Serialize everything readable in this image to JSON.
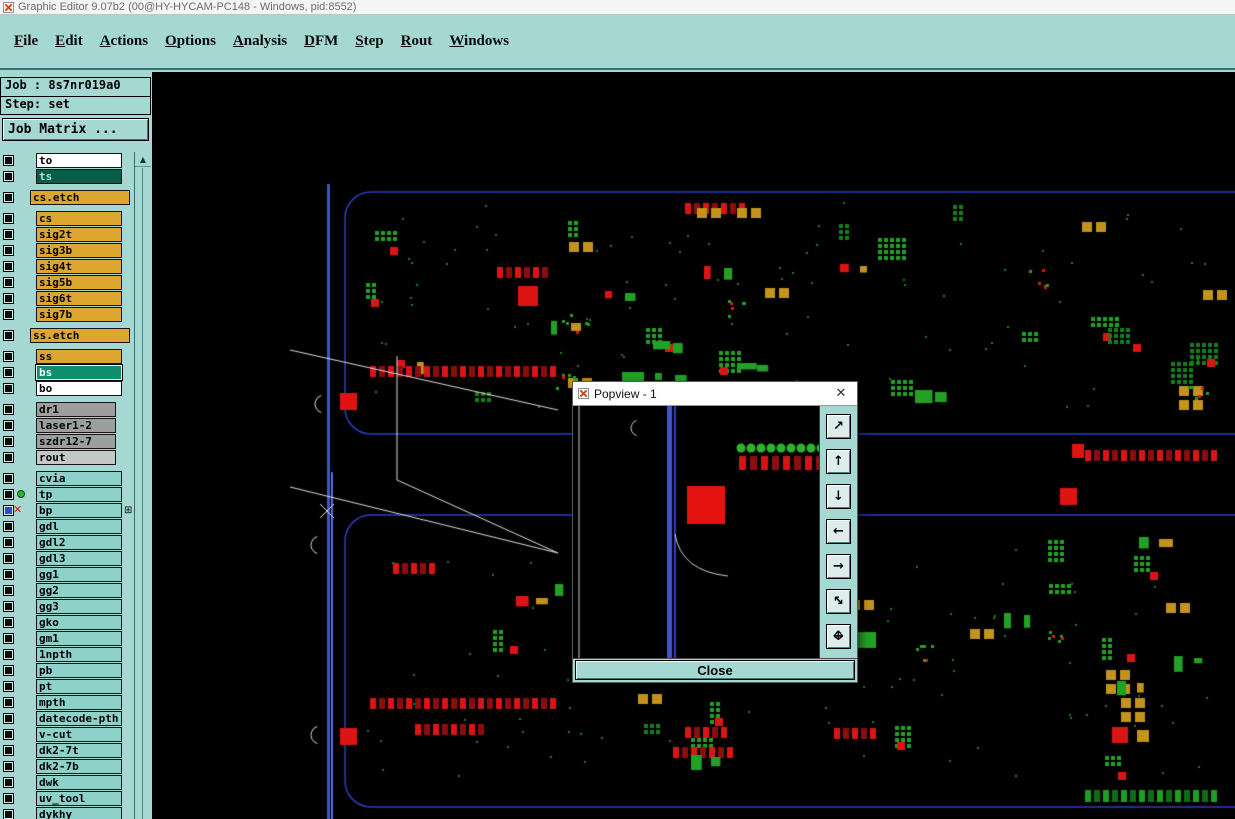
{
  "window": {
    "title": "Graphic Editor 9.07b2 (00@HY-HYCAM-PC148 - Windows, pid:8552)"
  },
  "menu": {
    "items": [
      "File",
      "Edit",
      "Actions",
      "Options",
      "Analysis",
      "DFM",
      "Step",
      "Rout",
      "Windows"
    ]
  },
  "job_panel": {
    "job_label": "Job : 8s7nr019a0",
    "step_label": "Step: set",
    "job_matrix_button": "Job Matrix ..."
  },
  "layers": [
    {
      "name": "to",
      "style": "white"
    },
    {
      "name": "ts",
      "style": "dark"
    },
    {
      "name": "cs.etch",
      "style": "gold",
      "gap": true,
      "wide": true
    },
    {
      "name": "cs",
      "style": "gold",
      "gap": true
    },
    {
      "name": "sig2t",
      "style": "gold"
    },
    {
      "name": "sig3b",
      "style": "gold"
    },
    {
      "name": "sig4t",
      "style": "gold"
    },
    {
      "name": "sig5b",
      "style": "gold"
    },
    {
      "name": "sig6t",
      "style": "gold"
    },
    {
      "name": "sig7b",
      "style": "gold"
    },
    {
      "name": "ss.etch",
      "style": "gold",
      "gap": true,
      "wide": true
    },
    {
      "name": "ss",
      "style": "gold",
      "gap": true
    },
    {
      "name": "bs",
      "style": "tealsel"
    },
    {
      "name": "bo",
      "style": "white"
    },
    {
      "name": "dr1",
      "style": "gray",
      "gap": true
    },
    {
      "name": "laser1-2",
      "style": "gray"
    },
    {
      "name": "szdr12-7",
      "style": "gray"
    },
    {
      "name": "rout",
      "style": "graylight"
    },
    {
      "name": "cvia",
      "style": "teal",
      "gap": true
    },
    {
      "name": "tp",
      "style": "teal",
      "icon": "green-dot"
    },
    {
      "name": "bp",
      "style": "teal",
      "icon": "red-cross",
      "chk": "blue",
      "grid": true
    },
    {
      "name": "gdl",
      "style": "teal"
    },
    {
      "name": "gdl2",
      "style": "teal"
    },
    {
      "name": "gdl3",
      "style": "teal"
    },
    {
      "name": "gg1",
      "style": "teal"
    },
    {
      "name": "gg2",
      "style": "teal"
    },
    {
      "name": "gg3",
      "style": "teal"
    },
    {
      "name": "gko",
      "style": "teal"
    },
    {
      "name": "gm1",
      "style": "teal"
    },
    {
      "name": "1npth",
      "style": "teal"
    },
    {
      "name": "pb",
      "style": "teal"
    },
    {
      "name": "pt",
      "style": "teal"
    },
    {
      "name": "mpth",
      "style": "teal"
    },
    {
      "name": "datecode-pth",
      "style": "teal"
    },
    {
      "name": "v-cut",
      "style": "teal"
    },
    {
      "name": "dk2-7t",
      "style": "teal"
    },
    {
      "name": "dk2-7b",
      "style": "teal"
    },
    {
      "name": "dwk",
      "style": "teal"
    },
    {
      "name": "uv_tool",
      "style": "teal"
    },
    {
      "name": "dykhy",
      "style": "teal"
    }
  ],
  "popview": {
    "title": "Popview - 1",
    "close_label": "Close",
    "tools": [
      {
        "name": "detach-view-button",
        "glyphs": [
          "↗"
        ]
      },
      {
        "name": "pan-up-button",
        "glyphs": [
          "↑"
        ]
      },
      {
        "name": "pan-down-button",
        "glyphs": [
          "↓"
        ]
      },
      {
        "name": "pan-left-button",
        "glyphs": [
          "←"
        ]
      },
      {
        "name": "pan-right-button",
        "glyphs": [
          "→"
        ]
      },
      {
        "name": "zoom-extents-button",
        "glyphs": [
          "↖",
          "↘"
        ]
      },
      {
        "name": "pan-free-button",
        "glyphs": [
          "↔",
          "↕"
        ]
      }
    ]
  },
  "icons": {
    "scroll_up": "▲",
    "close_x": "✕",
    "layer_off_x": "✕",
    "layer_grid": "⊞"
  },
  "colors": {
    "panel_teal": "#a6d8d3",
    "layer_gold": "#dca62f",
    "layer_teal": "#8ed1ca",
    "layer_gray": "#9e9e9e",
    "selected_layer_green": "#0e8f6b",
    "work_layer_dark": "#0a5c49",
    "pcb_green": "#22a126",
    "pcb_red": "#dd1414",
    "pcb_gold": "#c3931b",
    "trace_blue": "#4353c8"
  }
}
